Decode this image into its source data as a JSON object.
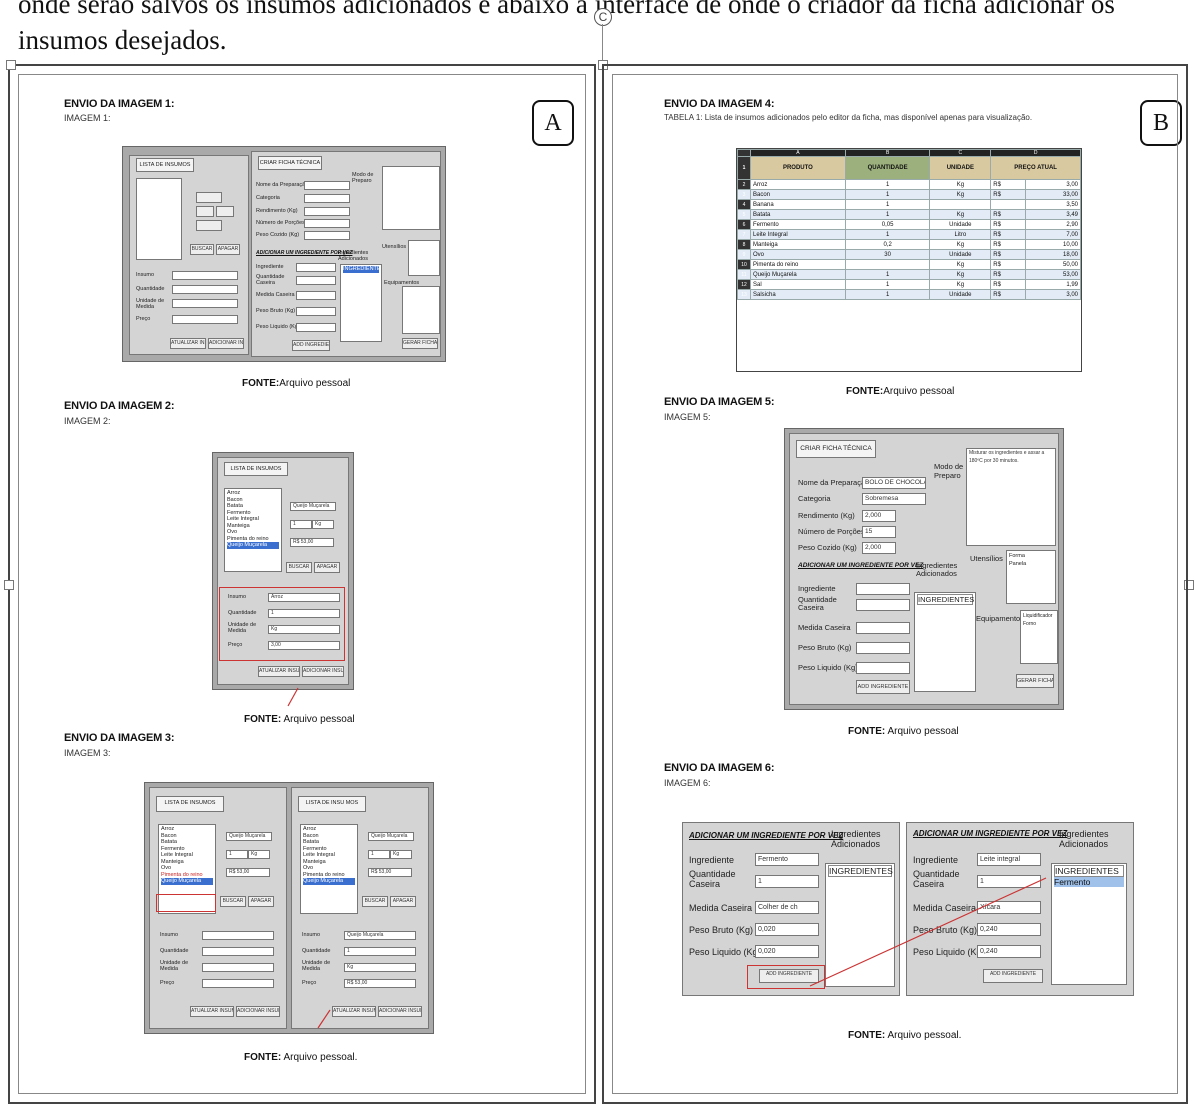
{
  "intro_text": "onde serão salvos os insumos adicionados e abaixo a interface de onde o criador da ficha adicionar os insumos desejados.",
  "circle_label": "C",
  "left": {
    "tag": "A",
    "img1": {
      "heading": "ENVIO DA IMAGEM 1:",
      "sub": "IMAGEM 1:",
      "fonte_b": "FONTE:",
      "fonte": "Arquivo pessoal"
    },
    "img2": {
      "heading": "ENVIO DA IMAGEM 2:",
      "sub": "IMAGEM 2:",
      "fonte_b": "FONTE:",
      "fonte": " Arquivo pessoal"
    },
    "img3": {
      "heading": "ENVIO DA IMAGEM 3:",
      "sub": "IMAGEM 3:",
      "fonte_b": "FONTE:",
      "fonte": " Arquivo pessoal."
    }
  },
  "right": {
    "tag": "B",
    "img4": {
      "heading": "ENVIO DA IMAGEM 4:",
      "sub": "TABELA 1: Lista de insumos adicionados pelo editor da ficha, mas disponível apenas para visualização.",
      "fonte_b": "FONTE:",
      "fonte": "Arquivo pessoal"
    },
    "img5": {
      "heading": "ENVIO DA IMAGEM 5:",
      "sub": "IMAGEM 5:",
      "fonte_b": "FONTE:",
      "fonte": " Arquivo pessoal"
    },
    "img6": {
      "heading": "ENVIO DA IMAGEM 6:",
      "sub": "IMAGEM 6:",
      "fonte_b": "FONTE:",
      "fonte": " Arquivo pessoal."
    }
  },
  "ui": {
    "lista_insumos": "LISTA DE INSUMOS",
    "lista_insumos_b": "LISTA DE INSU MOS",
    "criar_ficha": "CRIAR FICHA TÉCNICA",
    "insumo": "Insumo",
    "quantidade": "Quantidade",
    "unidade_medida": "Unidade de Medida",
    "preco": "Preço",
    "nome_preparacao": "Nome da Preparação",
    "categoria": "Categoria",
    "rendimento": "Rendimento (Kg)",
    "numero_porcoes": "Número de Porções",
    "peso_cozido": "Peso Cozido (Kg)",
    "modo_preparo": "Modo de Preparo",
    "utensilios": "Utensílios",
    "equipamentos": "Equipamentos",
    "adicionar_um": "ADICIONAR UM INGREDIENTE POR VEZ",
    "ingredientes_adicionados": "Ingredientes Adicionados",
    "ingrediente": "Ingrediente",
    "quantidade_caseira": "Quantidade Caseira",
    "medida_caseira": "Medida Caseira",
    "peso_bruto": "Peso Bruto (Kg)",
    "peso_liquido": "Peso Liquido (Kg)",
    "add_ingrediente": "ADD INGREDIENTE",
    "ingredientes_header": "INGREDIENTES",
    "buscar": "BUSCAR",
    "apagar": "APAGAR",
    "atualizar": "ATUALIZAR INSUMO",
    "adicionar_insumo": "ADICIONAR INSUMO",
    "gerar": "GERAR FICHA",
    "items": [
      "Arroz",
      "Bacon",
      "Batata",
      "Fermento",
      "Leite Integral",
      "Manteiga",
      "Ovo",
      "Pimenta do reino",
      "Queijo Muçarela"
    ],
    "img2_vals": {
      "insumo": "Arroz",
      "quantidade": "1",
      "unidade": "Kg",
      "preco": "3,00",
      "preview_name": "Queijo Muçarela",
      "preview_q": "1",
      "preview_u": "Kg",
      "preview_p": "R$ 53,00"
    },
    "img5_vals": {
      "nome": "BOLO DE CHOCOLATE",
      "categoria": "Sobremesa",
      "rendimento": "2,000",
      "porcoes": "15",
      "peso": "2,000",
      "modo": "Misturar os ingredientes e assar a 180ºC por 30 minutos.",
      "utensilios": [
        "Forma",
        "Panela"
      ],
      "equipamentos": [
        "Liquidificador",
        "Forno"
      ]
    },
    "img6a": {
      "ingrediente": "Fermento",
      "quantidade": "1",
      "medida": "Colher de ch",
      "bruto": "0,020",
      "liquido": "0,020"
    },
    "img6b": {
      "ingrediente": "Leite integral",
      "quantidade": "1",
      "medida": "Xícara",
      "bruto": "0,240",
      "liquido": "0,240",
      "added": "Fermento"
    }
  },
  "table": {
    "col_letters": [
      "A",
      "B",
      "C",
      "D"
    ],
    "headers": [
      "PRODUTO",
      "QUANTIDADE",
      "UNIDADE",
      "PREÇO ATUAL"
    ],
    "rows": [
      [
        "Arroz",
        "1",
        "Kg",
        "R$",
        "3,00"
      ],
      [
        "Bacon",
        "1",
        "Kg",
        "R$",
        "33,00"
      ],
      [
        "Banana",
        "1",
        "",
        "",
        "3,50"
      ],
      [
        "Batata",
        "1",
        "Kg",
        "R$",
        "3,49"
      ],
      [
        "Fermento",
        "0,05",
        "Unidade",
        "R$",
        "2,90"
      ],
      [
        "Leite Integral",
        "1",
        "Litro",
        "R$",
        "7,00"
      ],
      [
        "Manteiga",
        "0,2",
        "Kg",
        "R$",
        "10,00"
      ],
      [
        "Ovo",
        "30",
        "Unidade",
        "R$",
        "18,00"
      ],
      [
        "Pimenta do reino",
        "",
        "Kg",
        "R$",
        "50,00"
      ],
      [
        "Queijo Muçarela",
        "1",
        "Kg",
        "R$",
        "53,00"
      ],
      [
        "Sal",
        "1",
        "Kg",
        "R$",
        "1,99"
      ],
      [
        "Salsicha",
        "1",
        "Unidade",
        "R$",
        "3,00"
      ]
    ]
  }
}
